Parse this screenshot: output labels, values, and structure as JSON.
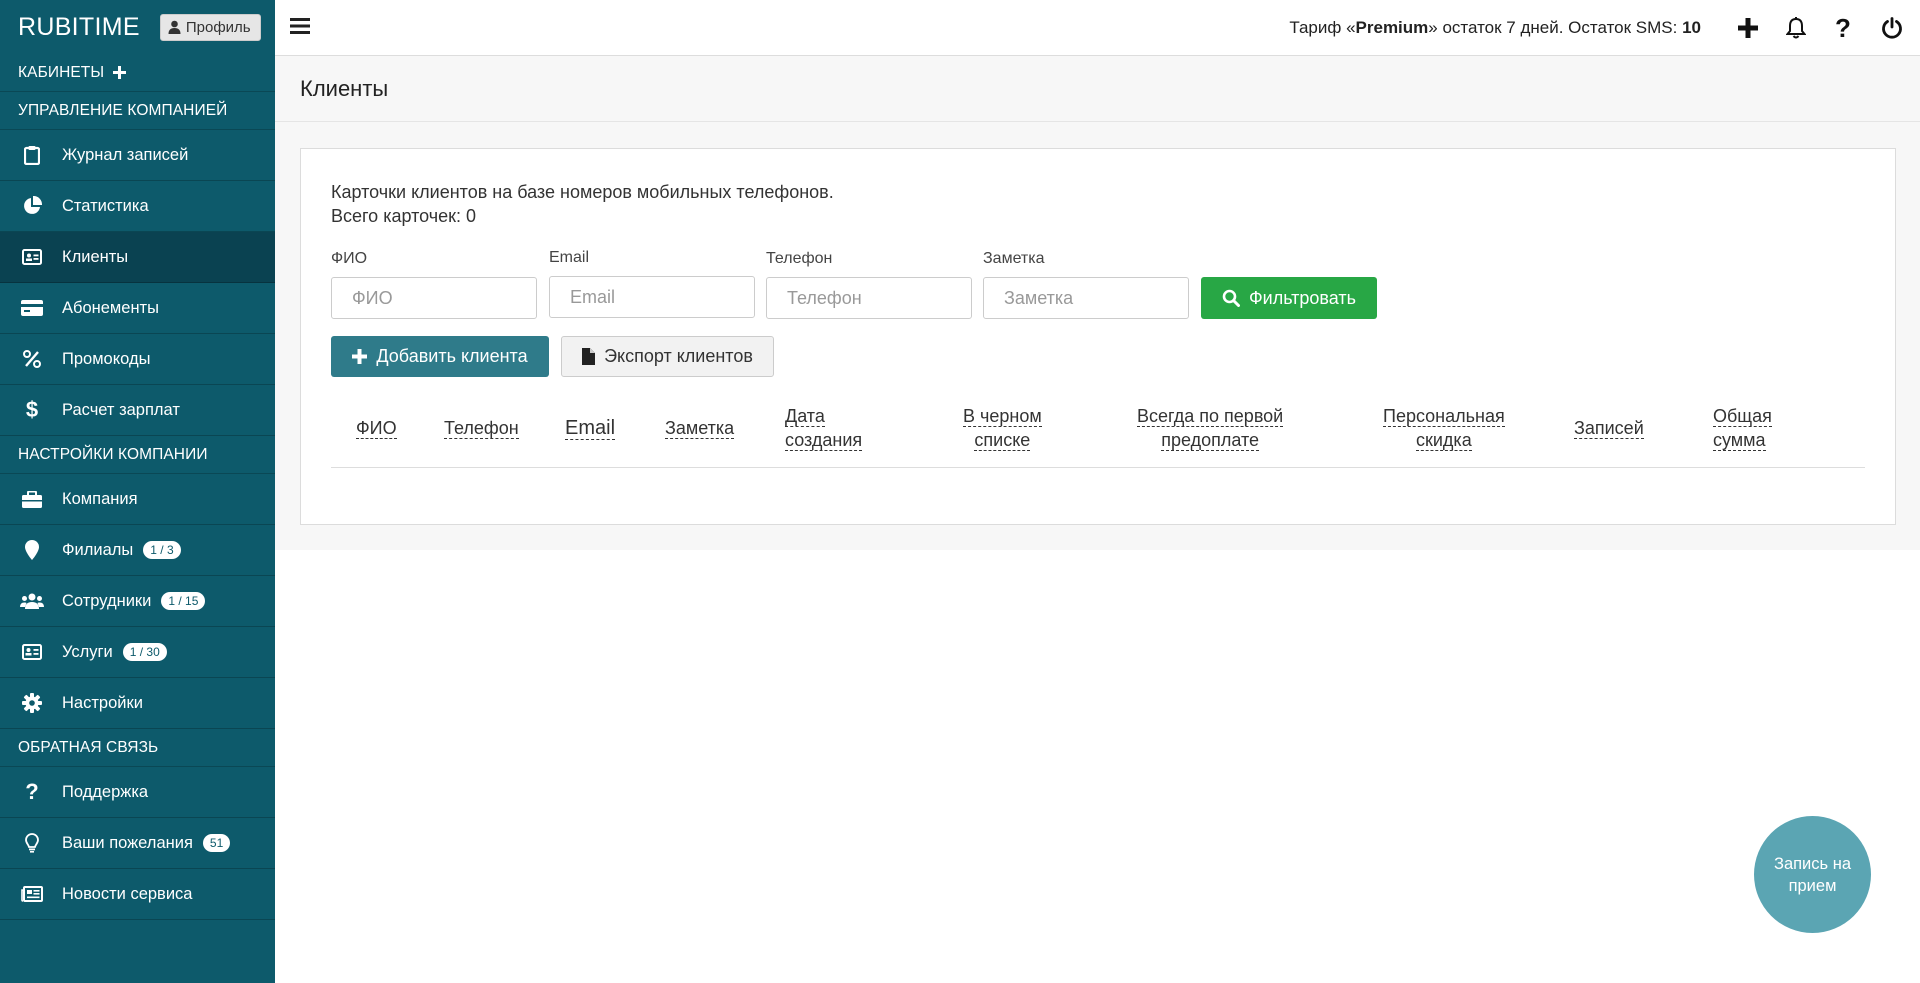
{
  "brand": "RUBITIME",
  "profile_label": "Профиль",
  "sidebar": {
    "sections": {
      "cabinets": "КАБИНЕТЫ",
      "management": "УПРАВЛЕНИЕ КОМПАНИЕЙ",
      "settings": "НАСТРОЙКИ КОМПАНИИ",
      "feedback": "ОБРАТНАЯ СВЯЗЬ"
    },
    "items": {
      "journal": "Журнал записей",
      "stats": "Статистика",
      "clients": "Клиенты",
      "subscriptions": "Абонементы",
      "promocodes": "Промокоды",
      "salary": "Расчет зарплат",
      "company": "Компания",
      "branches": "Филиалы",
      "branches_badge": "1 / 3",
      "staff": "Сотрудники",
      "staff_badge": "1 / 15",
      "services": "Услуги",
      "services_badge": "1 / 30",
      "settings": "Настройки",
      "support": "Поддержка",
      "wishes": "Ваши пожелания",
      "wishes_badge": "51",
      "news": "Новости сервиса"
    }
  },
  "topbar": {
    "tariff_prefix": "Тариф «",
    "tariff_name": "Premium",
    "tariff_suffix": "» остаток 7 дней. Остаток SMS: ",
    "sms_count": "10"
  },
  "page": {
    "title": "Клиенты",
    "desc_line1": "Карточки клиентов на базе номеров мобильных телефонов.",
    "desc_line2": "Всего карточек: 0"
  },
  "filters": {
    "fio_label": "ФИО",
    "fio_placeholder": "ФИО",
    "email_label": "Email",
    "email_placeholder": "Email",
    "phone_label": "Телефон",
    "phone_placeholder": "Телефон",
    "note_label": "Заметка",
    "note_placeholder": "Заметка",
    "filter_button": "Фильтровать"
  },
  "actions": {
    "add_client": "Добавить клиента",
    "export_clients": "Экспорт клиентов"
  },
  "table": {
    "headers": {
      "fio": "ФИО",
      "phone": "Телефон",
      "email": "Email",
      "note": "Заметка",
      "created_1": "Дата",
      "created_2": "создания",
      "blacklist_1": "В черном",
      "blacklist_2": "списке",
      "prepay_1": "Всегда по первой",
      "prepay_2": "предоплате",
      "discount_1": "Персональная",
      "discount_2": "скидка",
      "records": "Записей",
      "total_1": "Общая",
      "total_2": "сумма"
    }
  },
  "fab": {
    "line1": "Запись на",
    "line2": "прием"
  },
  "colors": {
    "sidebar": "#0d5a6b",
    "sidebar_active": "#0a4251",
    "filter_button": "#28a745",
    "add_button": "#2f7b8a",
    "fab": "#5ba5b3"
  },
  "icons": {
    "menu": "hamburger-icon",
    "add": "plus-icon",
    "notifications": "bell-icon",
    "help": "question-icon",
    "logout": "power-icon"
  }
}
